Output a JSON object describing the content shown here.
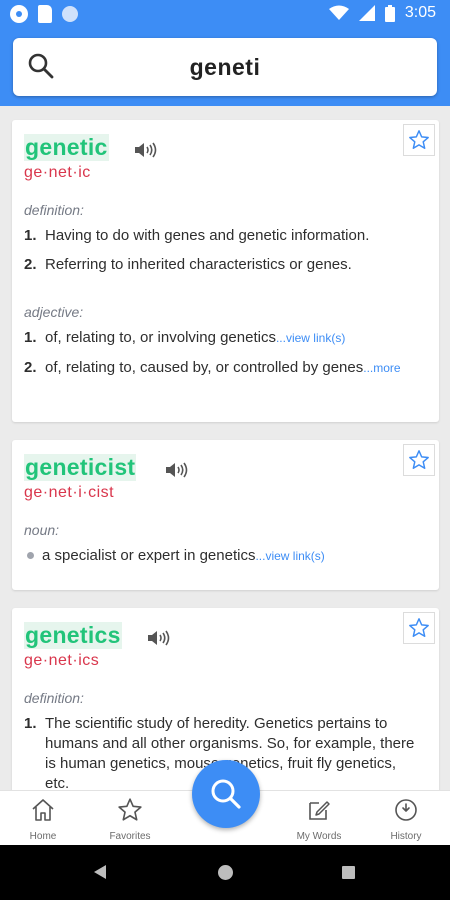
{
  "status_bar": {
    "time": "3:05"
  },
  "search": {
    "query": "geneti"
  },
  "entries": [
    {
      "word": "genetic",
      "syllables": "ge·net·ic",
      "sections": [
        {
          "pos": "definition:",
          "defs": [
            {
              "num": "1.",
              "text": "Having to do with genes and genetic  information.",
              "link": ""
            },
            {
              "num": "2.",
              "text": "Referring to inherited characteristics or genes.",
              "link": ""
            }
          ]
        },
        {
          "pos": "adjective:",
          "defs": [
            {
              "num": "1.",
              "text": "of, relating to, or involving genetics",
              "link": "...view link(s)"
            },
            {
              "num": "2.",
              "text": "of, relating to, caused by, or controlled by genes",
              "link": "...more"
            }
          ]
        }
      ]
    },
    {
      "word": "geneticist",
      "syllables": "ge·net·i·cist",
      "sections": [
        {
          "pos": "noun:",
          "defs": [
            {
              "text": "a specialist or expert in genetics",
              "link": "...view link(s)"
            }
          ]
        }
      ]
    },
    {
      "word": "genetics",
      "syllables": "ge·net·ics",
      "sections": [
        {
          "pos": "definition:",
          "defs": [
            {
              "num": "1.",
              "text": "The scientific study of heredity. Genetics pertains to humans and all other organisms. So, for example, there is human genetics, mouse genetics, fruit fly genetics, etc.",
              "link": ""
            }
          ]
        }
      ]
    }
  ],
  "bottom_nav": {
    "home": "Home",
    "favorites": "Favorites",
    "my_words": "My Words",
    "history": "History"
  },
  "colors": {
    "accent": "#3d8df5",
    "word": "#22c47a",
    "syllables": "#d9364c"
  }
}
